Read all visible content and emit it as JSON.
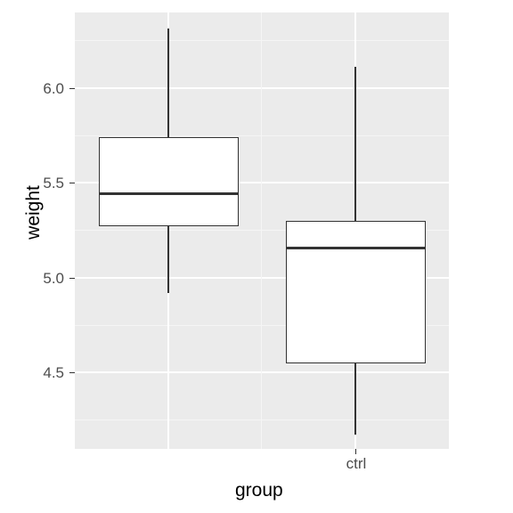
{
  "chart_data": {
    "type": "boxplot",
    "xlabel": "group",
    "ylabel": "weight",
    "categories": [
      "",
      "ctrl"
    ],
    "ylim": [
      4.1,
      6.4
    ],
    "y_ticks": [
      4.5,
      5.0,
      5.5,
      6.0
    ],
    "series": [
      {
        "name": "",
        "lower_whisker": 4.92,
        "q1": 5.27,
        "median": 5.44,
        "q3": 5.74,
        "upper_whisker": 6.31
      },
      {
        "name": "ctrl",
        "lower_whisker": 4.17,
        "q1": 4.55,
        "median": 5.16,
        "q3": 5.3,
        "upper_whisker": 6.11
      }
    ]
  },
  "axis": {
    "x_title": "group",
    "y_title": "weight",
    "x_tick_ctrl": "ctrl",
    "y_tick_0": "4.5",
    "y_tick_1": "5.0",
    "y_tick_2": "5.5",
    "y_tick_3": "6.0"
  }
}
